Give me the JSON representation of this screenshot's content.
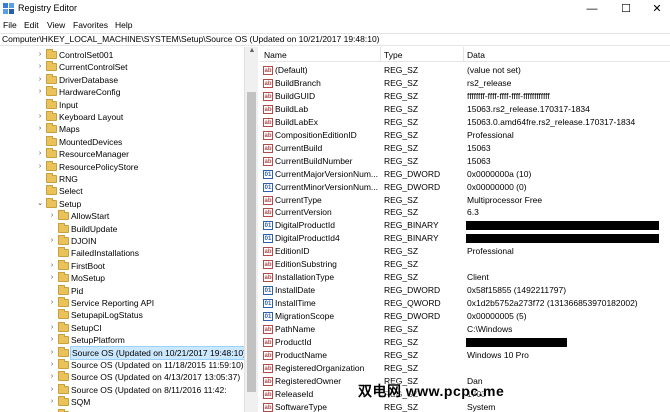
{
  "window": {
    "title": "Registry Editor",
    "minimize": "—",
    "maximize": "☐",
    "close": "✕"
  },
  "menu": [
    "File",
    "Edit",
    "View",
    "Favorites",
    "Help"
  ],
  "address": "Computer\\HKEY_LOCAL_MACHINE\\SYSTEM\\Setup\\Source OS (Updated on 10/21/2017 19:48:10)",
  "tree": [
    {
      "label": "ControlSet001",
      "level": 0,
      "caret": ">"
    },
    {
      "label": "CurrentControlSet",
      "level": 0,
      "caret": ">"
    },
    {
      "label": "DriverDatabase",
      "level": 0,
      "caret": ">"
    },
    {
      "label": "HardwareConfig",
      "level": 0,
      "caret": ">"
    },
    {
      "label": "Input",
      "level": 0,
      "caret": ""
    },
    {
      "label": "Keyboard Layout",
      "level": 0,
      "caret": ">"
    },
    {
      "label": "Maps",
      "level": 0,
      "caret": ">"
    },
    {
      "label": "MountedDevices",
      "level": 0,
      "caret": ""
    },
    {
      "label": "ResourceManager",
      "level": 0,
      "caret": ">"
    },
    {
      "label": "ResourcePolicyStore",
      "level": 0,
      "caret": ">"
    },
    {
      "label": "RNG",
      "level": 0,
      "caret": ""
    },
    {
      "label": "Select",
      "level": 0,
      "caret": ""
    },
    {
      "label": "Setup",
      "level": 0,
      "caret": "v"
    },
    {
      "label": "AllowStart",
      "level": 1,
      "caret": ">"
    },
    {
      "label": "BuildUpdate",
      "level": 1,
      "caret": ""
    },
    {
      "label": "DJOIN",
      "level": 1,
      "caret": ">"
    },
    {
      "label": "FailedInstallations",
      "level": 1,
      "caret": ""
    },
    {
      "label": "FirstBoot",
      "level": 1,
      "caret": ">"
    },
    {
      "label": "MoSetup",
      "level": 1,
      "caret": ">"
    },
    {
      "label": "Pid",
      "level": 1,
      "caret": ""
    },
    {
      "label": "Service Reporting API",
      "level": 1,
      "caret": ">"
    },
    {
      "label": "SetupapiLogStatus",
      "level": 1,
      "caret": ""
    },
    {
      "label": "SetupCI",
      "level": 1,
      "caret": ">"
    },
    {
      "label": "SetupPlatform",
      "level": 1,
      "caret": ">"
    },
    {
      "label": "Source OS (Updated on 10/21/2017 19:48:10)",
      "level": 1,
      "caret": ">",
      "selected": true
    },
    {
      "label": "Source OS (Updated on 11/18/2015 11:59:10)",
      "level": 1,
      "caret": ">"
    },
    {
      "label": "Source OS (Updated on 4/13/2017 13:05:37)",
      "level": 1,
      "caret": ">"
    },
    {
      "label": "Source OS (Updated on 8/11/2016 11:42:",
      "level": 1,
      "caret": ">"
    },
    {
      "label": "SQM",
      "level": 1,
      "caret": ">"
    },
    {
      "label": "St",
      "level": 1,
      "caret": ""
    }
  ],
  "columns": {
    "name": "Name",
    "type": "Type",
    "data": "Data"
  },
  "values": [
    {
      "name": "(Default)",
      "type": "REG_SZ",
      "data": "(value not set)",
      "icon": "sz"
    },
    {
      "name": "BuildBranch",
      "type": "REG_SZ",
      "data": "rs2_release",
      "icon": "sz"
    },
    {
      "name": "BuildGUID",
      "type": "REG_SZ",
      "data": "ffffffff-ffff-ffff-ffff-ffffffffffff",
      "icon": "sz"
    },
    {
      "name": "BuildLab",
      "type": "REG_SZ",
      "data": "15063.rs2_release.170317-1834",
      "icon": "sz"
    },
    {
      "name": "BuildLabEx",
      "type": "REG_SZ",
      "data": "15063.0.amd64fre.rs2_release.170317-1834",
      "icon": "sz"
    },
    {
      "name": "CompositionEditionID",
      "type": "REG_SZ",
      "data": "Professional",
      "icon": "sz"
    },
    {
      "name": "CurrentBuild",
      "type": "REG_SZ",
      "data": "15063",
      "icon": "sz"
    },
    {
      "name": "CurrentBuildNumber",
      "type": "REG_SZ",
      "data": "15063",
      "icon": "sz"
    },
    {
      "name": "CurrentMajorVersionNum...",
      "type": "REG_DWORD",
      "data": "0x0000000a (10)",
      "icon": "bin"
    },
    {
      "name": "CurrentMinorVersionNum...",
      "type": "REG_DWORD",
      "data": "0x00000000 (0)",
      "icon": "bin"
    },
    {
      "name": "CurrentType",
      "type": "REG_SZ",
      "data": "Multiprocessor Free",
      "icon": "sz"
    },
    {
      "name": "CurrentVersion",
      "type": "REG_SZ",
      "data": "6.3",
      "icon": "sz"
    },
    {
      "name": "DigitalProductId",
      "type": "REG_BINARY",
      "data": "",
      "icon": "bin",
      "redacted": "long"
    },
    {
      "name": "DigitalProductId4",
      "type": "REG_BINARY",
      "data": "",
      "icon": "bin",
      "redacted": "long"
    },
    {
      "name": "EditionID",
      "type": "REG_SZ",
      "data": "Professional",
      "icon": "sz"
    },
    {
      "name": "EditionSubstring",
      "type": "REG_SZ",
      "data": "",
      "icon": "sz"
    },
    {
      "name": "InstallationType",
      "type": "REG_SZ",
      "data": "Client",
      "icon": "sz"
    },
    {
      "name": "InstallDate",
      "type": "REG_DWORD",
      "data": "0x58f15855 (1492211797)",
      "icon": "bin"
    },
    {
      "name": "InstallTime",
      "type": "REG_QWORD",
      "data": "0x1d2b5752a273f72 (131366853970182002)",
      "icon": "bin"
    },
    {
      "name": "MigrationScope",
      "type": "REG_DWORD",
      "data": "0x00000005 (5)",
      "icon": "bin"
    },
    {
      "name": "PathName",
      "type": "REG_SZ",
      "data": "C:\\Windows",
      "icon": "sz"
    },
    {
      "name": "ProductId",
      "type": "REG_SZ",
      "data": "",
      "icon": "sz",
      "redacted": "short"
    },
    {
      "name": "ProductName",
      "type": "REG_SZ",
      "data": "Windows 10 Pro",
      "icon": "sz"
    },
    {
      "name": "RegisteredOrganization",
      "type": "REG_SZ",
      "data": "",
      "icon": "sz"
    },
    {
      "name": "RegisteredOwner",
      "type": "REG_SZ",
      "data": "Dan",
      "icon": "sz"
    },
    {
      "name": "ReleaseId",
      "type": "REG_SZ",
      "data": "1703",
      "icon": "sz"
    },
    {
      "name": "SoftwareType",
      "type": "REG_SZ",
      "data": "System",
      "icon": "sz"
    }
  ],
  "watermark": "双电网 www.pcpc.me"
}
